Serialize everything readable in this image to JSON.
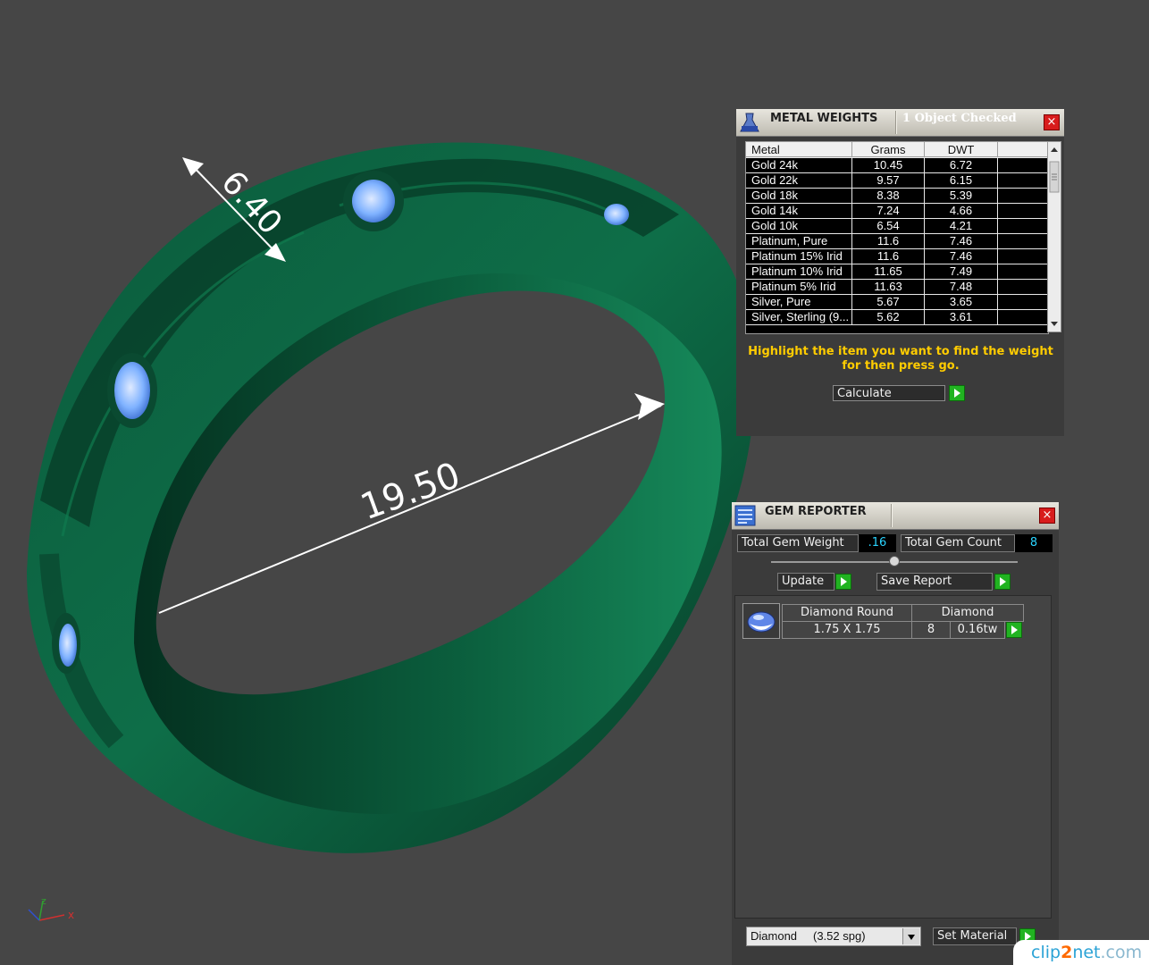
{
  "viewport": {
    "dimensions": {
      "width_value": "6.40",
      "diameter_value": "19.50"
    },
    "axis_labels": {
      "x": "x",
      "z": "z"
    },
    "ring_color": "#0e6a45",
    "gem_color": "#7fb2ff"
  },
  "metal_weights": {
    "title": "METAL WEIGHTS",
    "subtitle": "1 Object Checked",
    "close_symbol": "×",
    "columns": [
      "Metal",
      "Grams",
      "DWT"
    ],
    "rows": [
      {
        "metal": "Gold 24k",
        "grams": "10.45",
        "dwt": "6.72"
      },
      {
        "metal": "Gold 22k",
        "grams": "9.57",
        "dwt": "6.15"
      },
      {
        "metal": "Gold 18k",
        "grams": "8.38",
        "dwt": "5.39"
      },
      {
        "metal": "Gold 14k",
        "grams": "7.24",
        "dwt": "4.66"
      },
      {
        "metal": "Gold 10k",
        "grams": "6.54",
        "dwt": "4.21"
      },
      {
        "metal": "Platinum, Pure",
        "grams": "11.6",
        "dwt": "7.46"
      },
      {
        "metal": "Platinum 15% Irid",
        "grams": "11.6",
        "dwt": "7.46"
      },
      {
        "metal": "Platinum 10% Irid",
        "grams": "11.65",
        "dwt": "7.49"
      },
      {
        "metal": "Platinum 5% Irid",
        "grams": "11.63",
        "dwt": "7.48"
      },
      {
        "metal": "Silver, Pure",
        "grams": "5.67",
        "dwt": "3.65"
      },
      {
        "metal": "Silver, Sterling (9...",
        "grams": "5.62",
        "dwt": "3.61"
      }
    ],
    "instruction": "Highlight the item you want to find the weight for then press go.",
    "calculate_label": "Calculate"
  },
  "gem_reporter": {
    "title": "GEM REPORTER",
    "close_symbol": "×",
    "total_weight_label": "Total Gem Weight",
    "total_weight_value": ".16",
    "total_count_label": "Total Gem Count",
    "total_count_value": "8",
    "update_label": "Update",
    "save_report_label": "Save Report",
    "gems": [
      {
        "shape": "Diamond Round",
        "size": "1.75 X 1.75",
        "material": "Diamond",
        "count": "8",
        "weight": "0.16tw"
      }
    ],
    "material_select": {
      "name": "Diamond",
      "spg": "(3.52 spg)"
    },
    "set_material_label": "Set Material"
  },
  "watermark": {
    "brand_part1": "clip",
    "brand_part2": "2",
    "brand_part3": "net",
    "brand_tld": ".com"
  }
}
